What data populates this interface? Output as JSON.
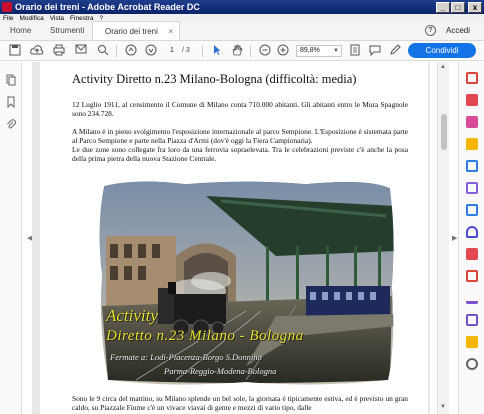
{
  "window": {
    "title": "Orario dei treni - Adobe Acrobat Reader DC",
    "minimize": "_",
    "maximize": "□",
    "close": "x"
  },
  "menu": [
    "File",
    "Modifica",
    "Vista",
    "Finestra",
    "?"
  ],
  "tabs": {
    "home": "Home",
    "tools": "Strumenti",
    "document": "Orario dei treni",
    "close_glyph": "×"
  },
  "header": {
    "help": "?",
    "signin": "Accedi"
  },
  "toolbar": {
    "page_current": "1",
    "page_total": "/ 3",
    "zoom": "89,8%",
    "share": "Condividi"
  },
  "document": {
    "title": "Activity Diretto n.23 Milano-Bologna (difficoltà: media)",
    "paragraphs": [
      "12 Luglio 1911, al censimento il Comune di Milano conta 710.000 abitanti. Gli abitanti entro le Mura Spagnole sono 234.728.",
      "A Milano è in pieno svolgimento l'esposizione internazionale al parco Sempione. L'Esposizione è sistemata parte al Parco Sempione e parte nella Piazza d'Armi (dov'è oggi la Fiera Campionaria).",
      " Le due zone sono collegate fra loro da una ferrovia sopraelevata. Tra le celebrazioni previste c'è anche la posa della prima pietra della nuova Stazione Centrale.",
      "Sono le 9 circa del mattino, su Milano splende un bel sole, la giornata è tipicamente estiva, ed è previsto un gran caldo, su Piazzale Fiume c'è un vivace viavai di gente e mezzi di vario tipo, dalle"
    ],
    "figure": {
      "line1": "Activity",
      "line2": "Diretto n.23 Milano - Bologna",
      "line3": "Fermate a: Lodi-Piacenza-Borgo S.Donnino",
      "line4": "Parma-Reggio-Modena-Bologna"
    }
  },
  "colors": {
    "accent": "#1473e6",
    "titlebar": "#0a246a",
    "figure_text": "#e9e22a"
  }
}
